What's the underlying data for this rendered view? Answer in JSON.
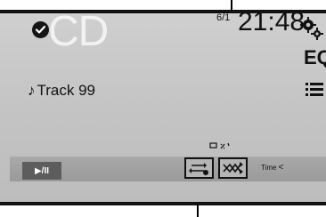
{
  "source": {
    "title": "CD"
  },
  "track": {
    "note_symbol": "♪",
    "name": "Track 99"
  },
  "track_counter": "6/1",
  "clock": "21:48",
  "header_buttons": {
    "eq_label": "EQ"
  },
  "playback": {
    "play_pause_label": "▶/II"
  },
  "time_control": {
    "label": "Time",
    "chevron": "<"
  },
  "icons": {
    "settings": "gear-icon",
    "menu": "list-icon",
    "select": "check-circle-icon",
    "repeat": "repeat-icon",
    "shuffle": "shuffle-icon"
  },
  "colors": {
    "screen_bg": "#c6c6c6",
    "title_text": "#f2f2f2",
    "control_bar": "#9e9e9e",
    "play_button": "#5d5d5d"
  }
}
